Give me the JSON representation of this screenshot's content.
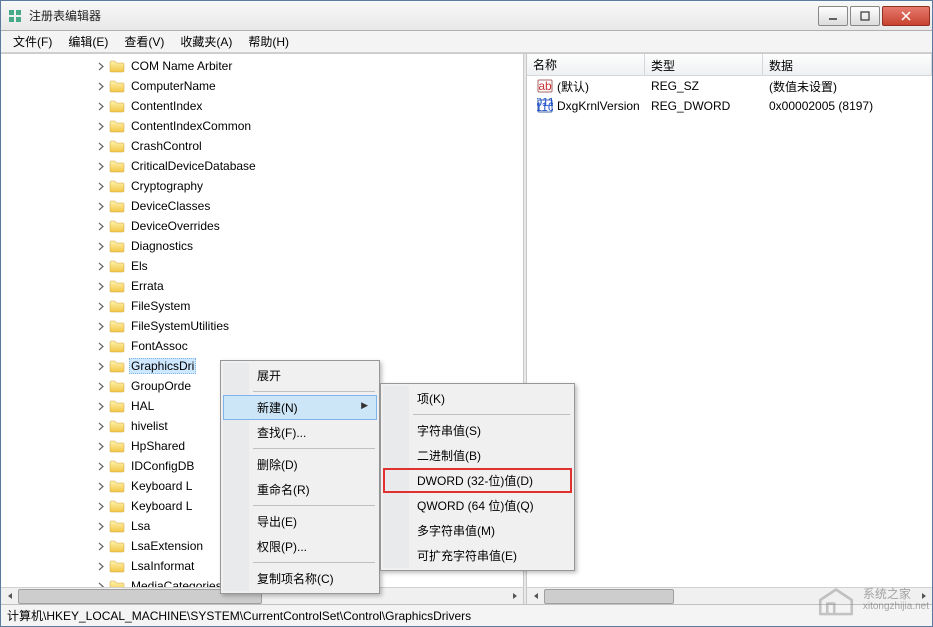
{
  "window": {
    "title": "注册表编辑器"
  },
  "menubar": [
    {
      "label": "文件(F)"
    },
    {
      "label": "编辑(E)"
    },
    {
      "label": "查看(V)"
    },
    {
      "label": "收藏夹(A)"
    },
    {
      "label": "帮助(H)"
    }
  ],
  "tree": {
    "items": [
      {
        "label": "COM Name Arbiter",
        "indent": 5
      },
      {
        "label": "ComputerName",
        "indent": 5
      },
      {
        "label": "ContentIndex",
        "indent": 5
      },
      {
        "label": "ContentIndexCommon",
        "indent": 5
      },
      {
        "label": "CrashControl",
        "indent": 5
      },
      {
        "label": "CriticalDeviceDatabase",
        "indent": 5
      },
      {
        "label": "Cryptography",
        "indent": 5
      },
      {
        "label": "DeviceClasses",
        "indent": 5
      },
      {
        "label": "DeviceOverrides",
        "indent": 5
      },
      {
        "label": "Diagnostics",
        "indent": 5
      },
      {
        "label": "Els",
        "indent": 5
      },
      {
        "label": "Errata",
        "indent": 5
      },
      {
        "label": "FileSystem",
        "indent": 5
      },
      {
        "label": "FileSystemUtilities",
        "indent": 5
      },
      {
        "label": "FontAssoc",
        "indent": 5
      },
      {
        "label": "GraphicsDrivers",
        "indent": 5,
        "selected": true,
        "shortLabel": "GraphicsDri"
      },
      {
        "label": "GroupOrderList",
        "indent": 5,
        "shortLabel": "GroupOrde"
      },
      {
        "label": "HAL",
        "indent": 5
      },
      {
        "label": "hivelist",
        "indent": 5
      },
      {
        "label": "HpShared",
        "indent": 5
      },
      {
        "label": "IDConfigDB",
        "indent": 5
      },
      {
        "label": "Keyboard Layout",
        "indent": 5,
        "shortLabel": "Keyboard L"
      },
      {
        "label": "Keyboard Layouts",
        "indent": 5,
        "shortLabel": "Keyboard L"
      },
      {
        "label": "Lsa",
        "indent": 5
      },
      {
        "label": "LsaExtensionConfig",
        "indent": 5,
        "shortLabel": "LsaExtension"
      },
      {
        "label": "LsaInformation",
        "indent": 5,
        "shortLabel": "LsaInformat"
      },
      {
        "label": "MediaCategories",
        "indent": 5
      }
    ]
  },
  "list": {
    "headers": {
      "name": "名称",
      "type": "类型",
      "data": "数据"
    },
    "rows": [
      {
        "icon": "str",
        "name": "(默认)",
        "type": "REG_SZ",
        "data": "(数值未设置)"
      },
      {
        "icon": "bin",
        "name": "DxgKrnlVersion",
        "type": "REG_DWORD",
        "data": "0x00002005 (8197)"
      }
    ]
  },
  "context_menu_1": {
    "items": [
      {
        "label": "展开",
        "type": "item"
      },
      {
        "type": "sep"
      },
      {
        "label": "新建(N)",
        "type": "item",
        "submenu": true,
        "hover": true
      },
      {
        "label": "查找(F)...",
        "type": "item"
      },
      {
        "type": "sep"
      },
      {
        "label": "删除(D)",
        "type": "item"
      },
      {
        "label": "重命名(R)",
        "type": "item"
      },
      {
        "type": "sep"
      },
      {
        "label": "导出(E)",
        "type": "item"
      },
      {
        "label": "权限(P)...",
        "type": "item"
      },
      {
        "type": "sep"
      },
      {
        "label": "复制项名称(C)",
        "type": "item"
      }
    ]
  },
  "context_menu_2": {
    "items": [
      {
        "label": "项(K)",
        "type": "item"
      },
      {
        "type": "sep"
      },
      {
        "label": "字符串值(S)",
        "type": "item"
      },
      {
        "label": "二进制值(B)",
        "type": "item"
      },
      {
        "label": "DWORD (32-位)值(D)",
        "type": "item",
        "highlight": true
      },
      {
        "label": "QWORD (64 位)值(Q)",
        "type": "item"
      },
      {
        "label": "多字符串值(M)",
        "type": "item"
      },
      {
        "label": "可扩充字符串值(E)",
        "type": "item"
      }
    ]
  },
  "statusbar": {
    "path": "计算机\\HKEY_LOCAL_MACHINE\\SYSTEM\\CurrentControlSet\\Control\\GraphicsDrivers"
  },
  "watermark": {
    "line1": "系统之家",
    "line2": "xitongzhijia.net"
  }
}
